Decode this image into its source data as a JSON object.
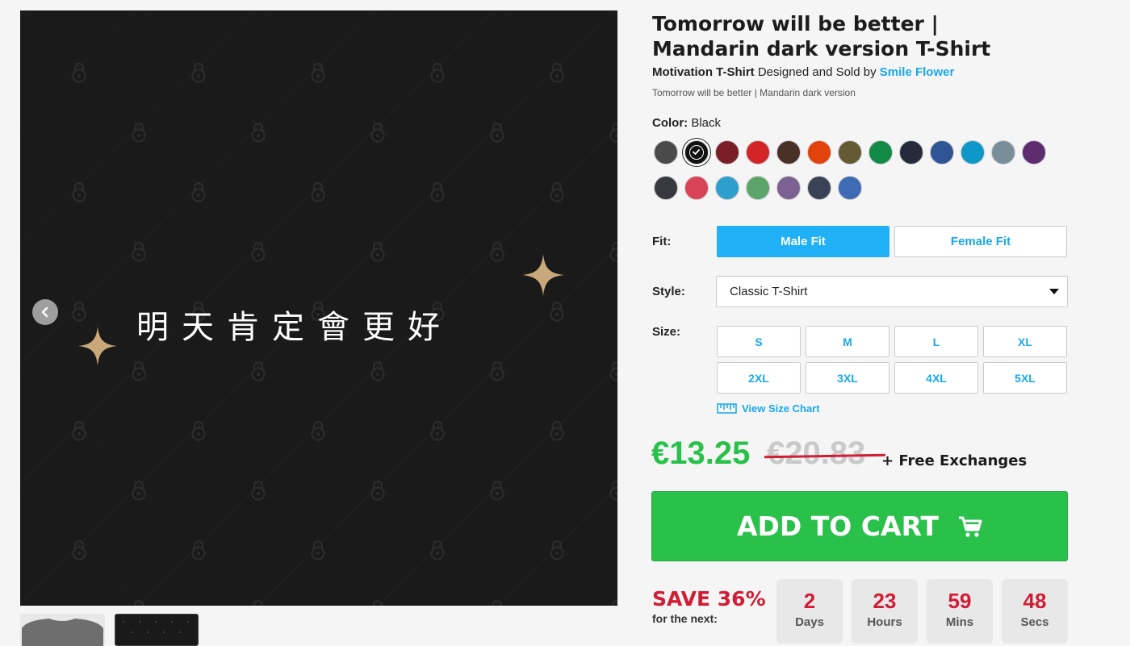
{
  "product": {
    "title": "Tomorrow will be better | Mandarin dark version T-Shirt",
    "category": "Motivation T-Shirt",
    "byline_middle": " Designed and Sold by ",
    "seller": "Smile Flower",
    "subtitle": "Tomorrow will be better | Mandarin dark version",
    "image_text": "明天肯定會更好"
  },
  "color": {
    "label": "Color:",
    "selected": "Black",
    "swatches": [
      {
        "name": "charcoal",
        "hex": "#4a4a4a"
      },
      {
        "name": "black",
        "hex": "#111111",
        "selected": true
      },
      {
        "name": "maroon",
        "hex": "#7a1e28"
      },
      {
        "name": "red",
        "hex": "#d32428"
      },
      {
        "name": "brown",
        "hex": "#4a3128"
      },
      {
        "name": "orange",
        "hex": "#e2430c"
      },
      {
        "name": "military-green",
        "hex": "#645a33"
      },
      {
        "name": "kelly-green",
        "hex": "#148a48"
      },
      {
        "name": "navy",
        "hex": "#262b3c"
      },
      {
        "name": "royal-blue",
        "hex": "#2f5596"
      },
      {
        "name": "sapphire",
        "hex": "#0e98c9"
      },
      {
        "name": "slate-grey",
        "hex": "#7a8e9a"
      },
      {
        "name": "purple",
        "hex": "#5d2d70"
      },
      {
        "name": "heather-dark-grey",
        "hex": "#38393f"
      },
      {
        "name": "heather-red",
        "hex": "#d94357"
      },
      {
        "name": "heather-sapphire",
        "hex": "#2d9fcd"
      },
      {
        "name": "heather-green",
        "hex": "#5ba56b"
      },
      {
        "name": "heather-purple",
        "hex": "#7c6194"
      },
      {
        "name": "heather-navy",
        "hex": "#3a4256"
      },
      {
        "name": "heather-royal",
        "hex": "#3e6bb3"
      }
    ]
  },
  "fit": {
    "label": "Fit:",
    "options": [
      "Male Fit",
      "Female Fit"
    ],
    "selected": "Male Fit"
  },
  "style": {
    "label": "Style:",
    "value": "Classic T-Shirt"
  },
  "size": {
    "label": "Size:",
    "options": [
      "S",
      "M",
      "L",
      "XL",
      "2XL",
      "3XL",
      "4XL",
      "5XL"
    ],
    "chart_link": "View Size Chart"
  },
  "price": {
    "current": "€13.25",
    "original": "€20.83",
    "extra": "+ Free Exchanges"
  },
  "cart": {
    "label": "ADD TO CART",
    "icon": "cart-icon"
  },
  "sale": {
    "save_text": "SAVE 36%",
    "sub_text": "for the next:",
    "countdown": [
      {
        "value": "2",
        "unit": "Days"
      },
      {
        "value": "23",
        "unit": "Hours"
      },
      {
        "value": "59",
        "unit": "Mins"
      },
      {
        "value": "48",
        "unit": "Secs"
      }
    ]
  },
  "theme": {
    "accent": "#1aa8ec",
    "price_green": "#2ac14b",
    "sale_red": "#d21c34",
    "sparkle": "#c9a97a"
  }
}
